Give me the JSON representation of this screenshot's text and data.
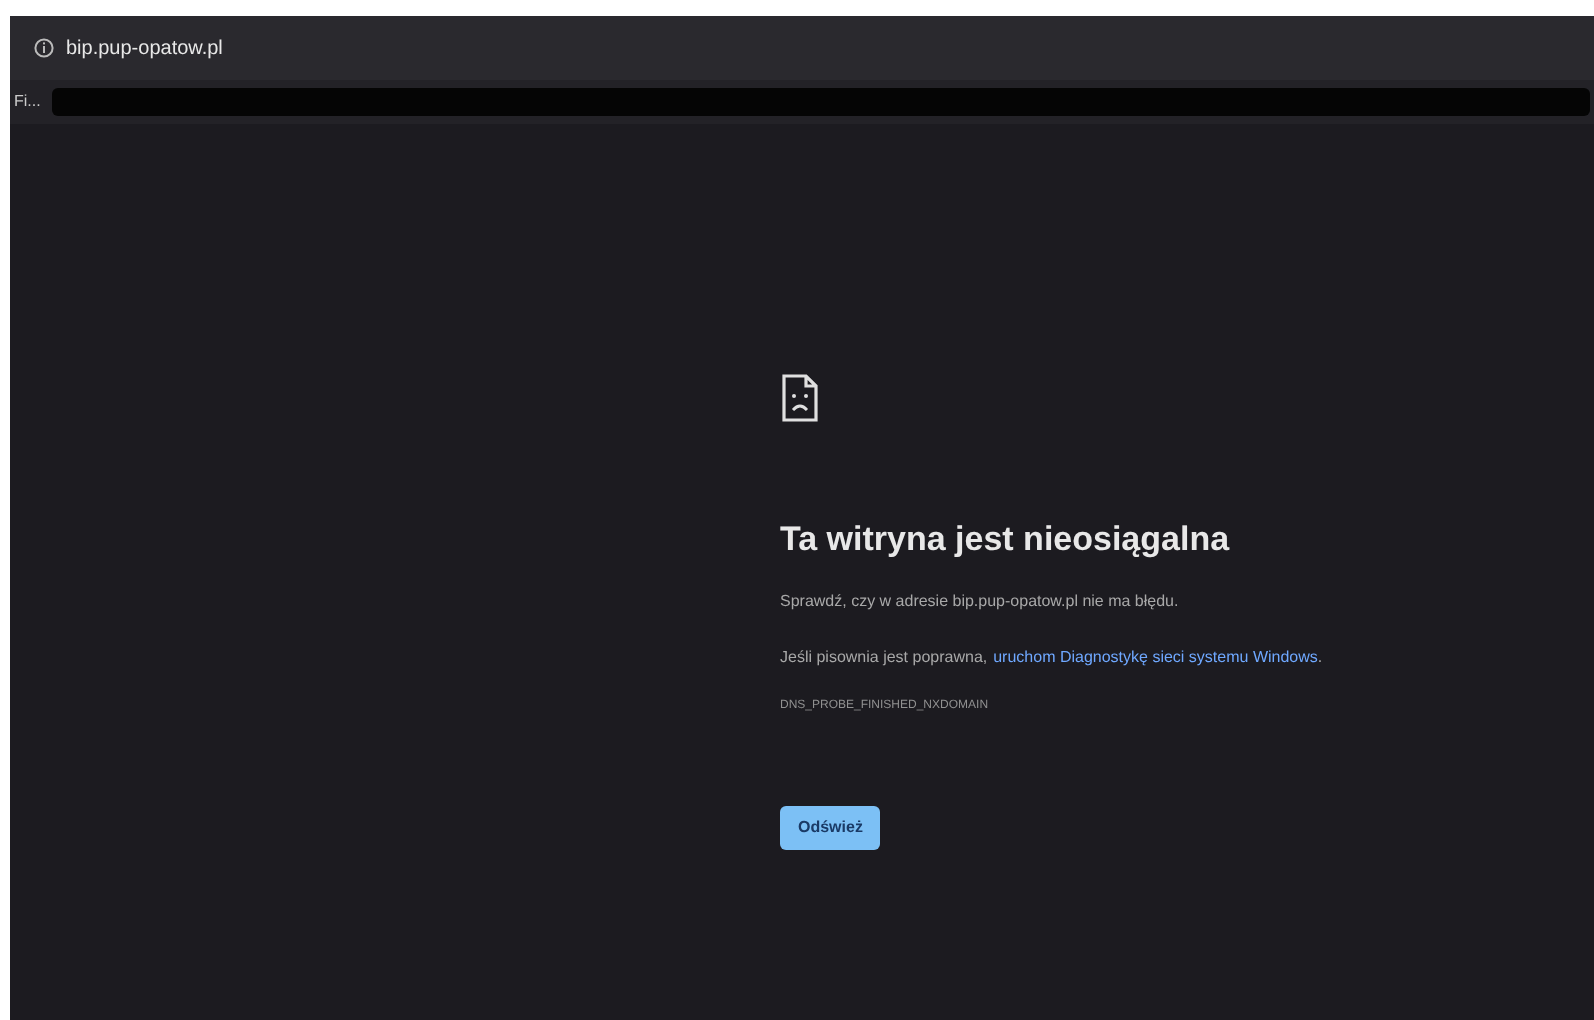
{
  "address_bar": {
    "url": "bip.pup-opatow.pl"
  },
  "bookmarks_bar": {
    "label": "Fi..."
  },
  "error": {
    "title": "Ta witryna jest nieosiągalna",
    "check_text": "Sprawdź, czy w adresie bip.pup-opatow.pl nie ma błędu.",
    "hint_text": "Jeśli pisownia jest poprawna,",
    "hint_link": "uruchom Diagnostykę sieci systemu Windows",
    "hint_end": ".",
    "code": "DNS_PROBE_FINISHED_NXDOMAIN",
    "button": "Odśwież"
  }
}
